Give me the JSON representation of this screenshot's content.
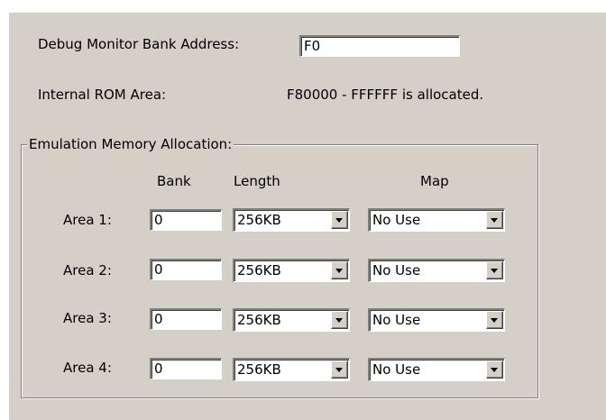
{
  "debug_monitor": {
    "label": "Debug Monitor Bank Address:",
    "value": "F0"
  },
  "internal_rom": {
    "label": "Internal ROM Area:",
    "value": "F80000 - FFFFFF is allocated."
  },
  "emulation": {
    "title": "Emulation Memory Allocation:",
    "headers": {
      "bank": "Bank",
      "length": "Length",
      "map": "Map"
    },
    "areas": [
      {
        "label": "Area 1:",
        "bank": "0",
        "length": "256KB",
        "map": "No Use"
      },
      {
        "label": "Area 2:",
        "bank": "0",
        "length": "256KB",
        "map": "No Use"
      },
      {
        "label": "Area 3:",
        "bank": "0",
        "length": "256KB",
        "map": "No Use"
      },
      {
        "label": "Area 4:",
        "bank": "0",
        "length": "256KB",
        "map": "No Use"
      }
    ]
  }
}
